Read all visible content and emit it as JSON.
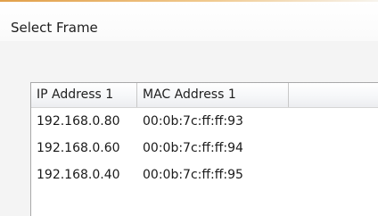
{
  "frame": {
    "title": "Select Frame"
  },
  "table": {
    "columns": [
      "IP Address 1",
      "MAC Address 1"
    ],
    "rows": [
      {
        "ip": "192.168.0.80",
        "mac": "00:0b:7c:ff:ff:93"
      },
      {
        "ip": "192.168.0.60",
        "mac": "00:0b:7c:ff:ff:94"
      },
      {
        "ip": "192.168.0.40",
        "mac": "00:0b:7c:ff:ff:95"
      }
    ]
  },
  "colors": {
    "accent_rule": "#e2a04a",
    "panel_background": "#f4f4f4",
    "list_border": "#a9a9a9"
  }
}
